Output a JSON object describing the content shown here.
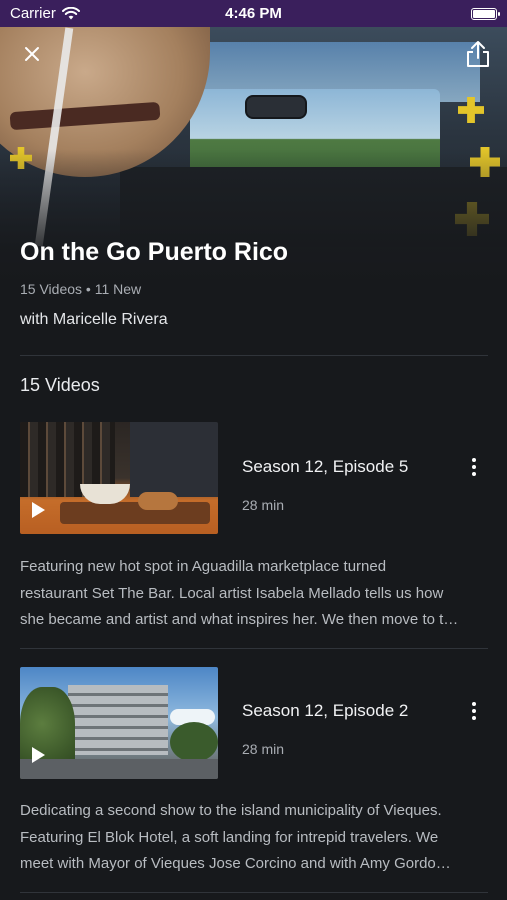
{
  "status_bar": {
    "carrier": "Carrier",
    "time": "4:46 PM",
    "battery_level": 1.0
  },
  "hero": {
    "close_icon": "close-icon",
    "share_icon": "share-icon"
  },
  "show": {
    "title": "On the Go Puerto Rico",
    "meta": "15 Videos • 11 New",
    "host": "with Maricelle Rivera"
  },
  "section_title": "15 Videos",
  "episodes": [
    {
      "title": "Season 12, Episode 5",
      "duration": "28 min",
      "description_lines": [
        "Featuring new hot spot in Aguadilla marketplace turned",
        "restaurant Set The Bar. Local artist Isabela Mellado tells us how",
        "she became and artist and what inspires her. We then move to t…"
      ]
    },
    {
      "title": "Season 12, Episode 2",
      "duration": "28 min",
      "description_lines": [
        "Dedicating a second show to the island municipality of Vieques.",
        "Featuring El Blok Hotel, a soft landing for intrepid travelers. We",
        "meet with Mayor of Vieques Jose Corcino and with Amy Gordo…"
      ]
    }
  ],
  "colors": {
    "background": "#17191c",
    "status_bar": "#3a1f5c",
    "accent_deco": "#e3c52a"
  }
}
